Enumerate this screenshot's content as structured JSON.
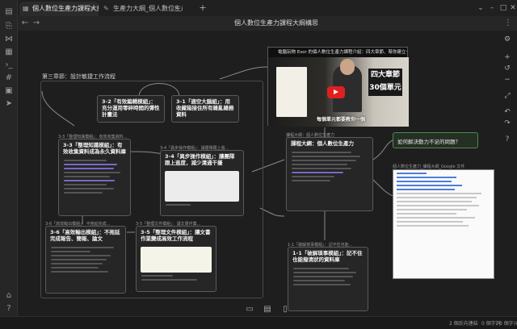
{
  "tabs": [
    {
      "label": "個人數位生產力課程大綱構思",
      "active": true
    },
    {
      "label": "生產力大綱_個人數位生產力",
      "active": false
    }
  ],
  "page": {
    "title": "個人數位生產力課程大綱構思"
  },
  "canvas": {
    "group_title": "第三章節：設計敏捷工作流程",
    "cards": [
      {
        "id": "c32",
        "title": "3-2「有效編輯模組」：充分運用零碎時間的彈性計畫法"
      },
      {
        "id": "c31",
        "title": "3-1「適空大腦組」：用收藏箱接住所有雜亂雜務資料"
      },
      {
        "id": "c33",
        "title": "3-3「整理知識模組」：有效收集資料成為永久資料庫"
      },
      {
        "id": "c34",
        "title": "3-4「異步操作模組」：讓團隊跟上進度，減少溝通干擾"
      },
      {
        "id": "c36",
        "title": "3-6「高效輸出模組」：不拖延完成報告、簡報、論文"
      },
      {
        "id": "c35",
        "title": "3-5「整理文件模組」：讓文書作業變成高效工作流程"
      },
      {
        "id": "c11",
        "title": "1-1「破解瑣事模組」：記不住也能撥清狀的資料庫"
      },
      {
        "id": "main",
        "title": "課程大綱：個人數位生產力"
      }
    ],
    "node_labels": [
      {
        "id": "l33",
        "text": "3-3「整理知識模組」：有效收集資料…"
      },
      {
        "id": "l34",
        "text": "3-4「異步操作模組」：讓團隊跟上進…"
      },
      {
        "id": "l36",
        "text": "3-6「高效輸出模組」：不拖延完成…"
      },
      {
        "id": "l35",
        "text": "3-5「整理文件模組」：讓文書作業…"
      },
      {
        "id": "l11",
        "text": "1-1「破解瑣事模組」：記不住也能…"
      },
      {
        "id": "lmain",
        "text": "課程大綱：個人數位生產力"
      },
      {
        "id": "ldoc",
        "text": "個人數位生產力_課程大綱_Google 文件"
      }
    ],
    "video": {
      "top_text": "電腦玩物 Esor 的個人數位生產力課程介紹：四大章節、幫你建立一套數位時代工作流",
      "banner": "四大章節 30個單元",
      "caption": "每個單元都要教你一個"
    },
    "question": "如何解決動力不足的問題？"
  },
  "status": {
    "backlinks": "2 個反向連結",
    "words": "0 個字詞",
    "chars": "0 個字元"
  },
  "icons": {
    "left_rail": [
      "file-icon",
      "graph-icon",
      "canvas-icon",
      "command-icon",
      "tag-icon",
      "calendar-icon",
      "send-icon"
    ],
    "right_tools": [
      "settings-icon",
      "zoom-in-icon",
      "zoom-out-icon",
      "fit-icon",
      "help-icon"
    ],
    "bottom": [
      "new-card-icon",
      "new-note-icon",
      "new-file-icon"
    ]
  },
  "colors": {
    "accent": "#7a68c8",
    "green": "#4f8a4f",
    "play": "#e02020"
  }
}
